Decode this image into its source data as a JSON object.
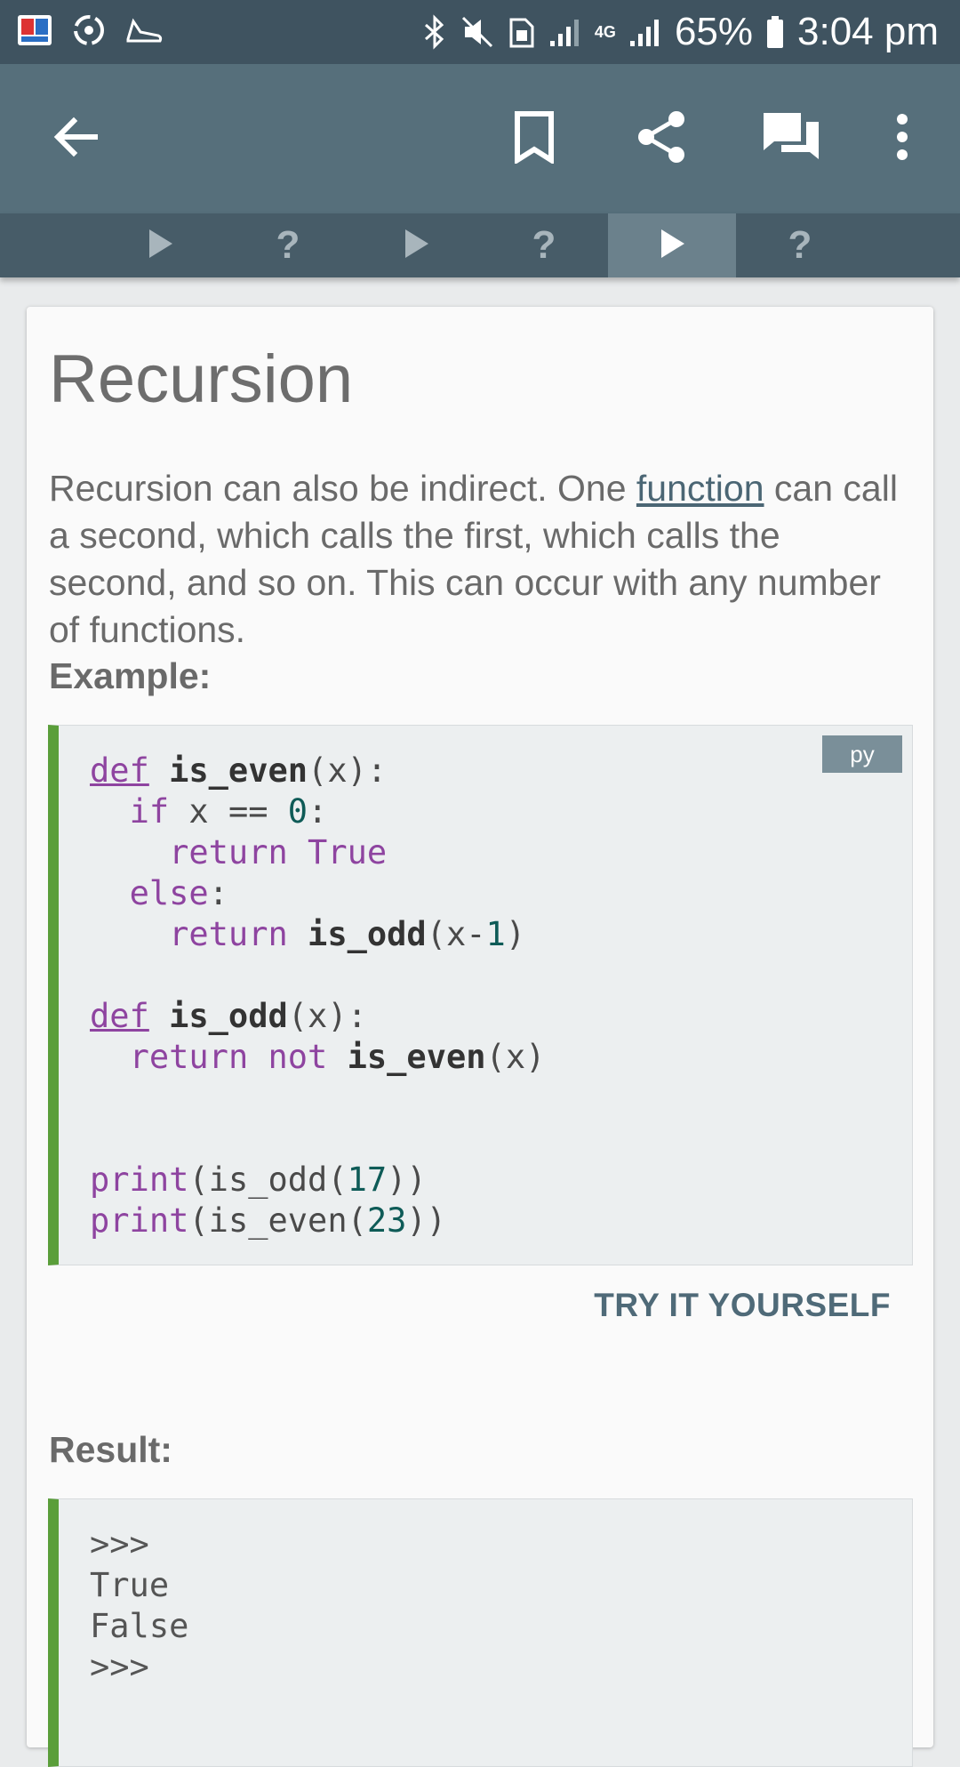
{
  "status_bar": {
    "battery": "65%",
    "time": "3:04 pm",
    "network": "4G",
    "icons": [
      "app-notification-icon",
      "sync-icon",
      "shoe-icon",
      "bluetooth-icon",
      "mute-icon",
      "sim-icon",
      "signal-icon",
      "battery-icon"
    ]
  },
  "app_bar": {
    "icons": [
      "back-arrow-icon",
      "bookmark-icon",
      "share-icon",
      "comments-icon",
      "more-vert-icon"
    ]
  },
  "tabs": [
    {
      "type": "lesson",
      "glyph": "▶",
      "active": false
    },
    {
      "type": "quiz",
      "glyph": "?",
      "active": false
    },
    {
      "type": "lesson",
      "glyph": "▶",
      "active": false
    },
    {
      "type": "quiz",
      "glyph": "?",
      "active": false
    },
    {
      "type": "lesson",
      "glyph": "▶",
      "active": true
    },
    {
      "type": "quiz",
      "glyph": "?",
      "active": false
    }
  ],
  "lesson": {
    "title": "Recursion",
    "para_before": "Recursion can also be indirect. One ",
    "link": "function",
    "para_after": " can call a second, which calls the first, which calls the second, and so on. This can occur with any number of functions.",
    "example_label": "Example:",
    "code_lang": "py",
    "code_lines": [
      "def is_even(x):",
      "  if x == 0:",
      "    return True",
      "  else:",
      "    return is_odd(x-1)",
      "",
      "def is_odd(x):",
      "  return not is_even(x)",
      "",
      "",
      "print(is_odd(17))",
      "print(is_even(23))"
    ],
    "try_label": "TRY IT YOURSELF",
    "result_label": "Result:",
    "result_lines": [
      ">>>",
      "True",
      "False",
      ">>>"
    ]
  },
  "colors": {
    "status_bar": "#3f5360",
    "app_bar": "#566f7b",
    "tab_bar": "#475c68",
    "active_tab": "#6b818c",
    "code_accent": "#5a9e3a",
    "keyword": "#8e44a0",
    "number": "#0e5b57",
    "link": "#4b6674"
  }
}
